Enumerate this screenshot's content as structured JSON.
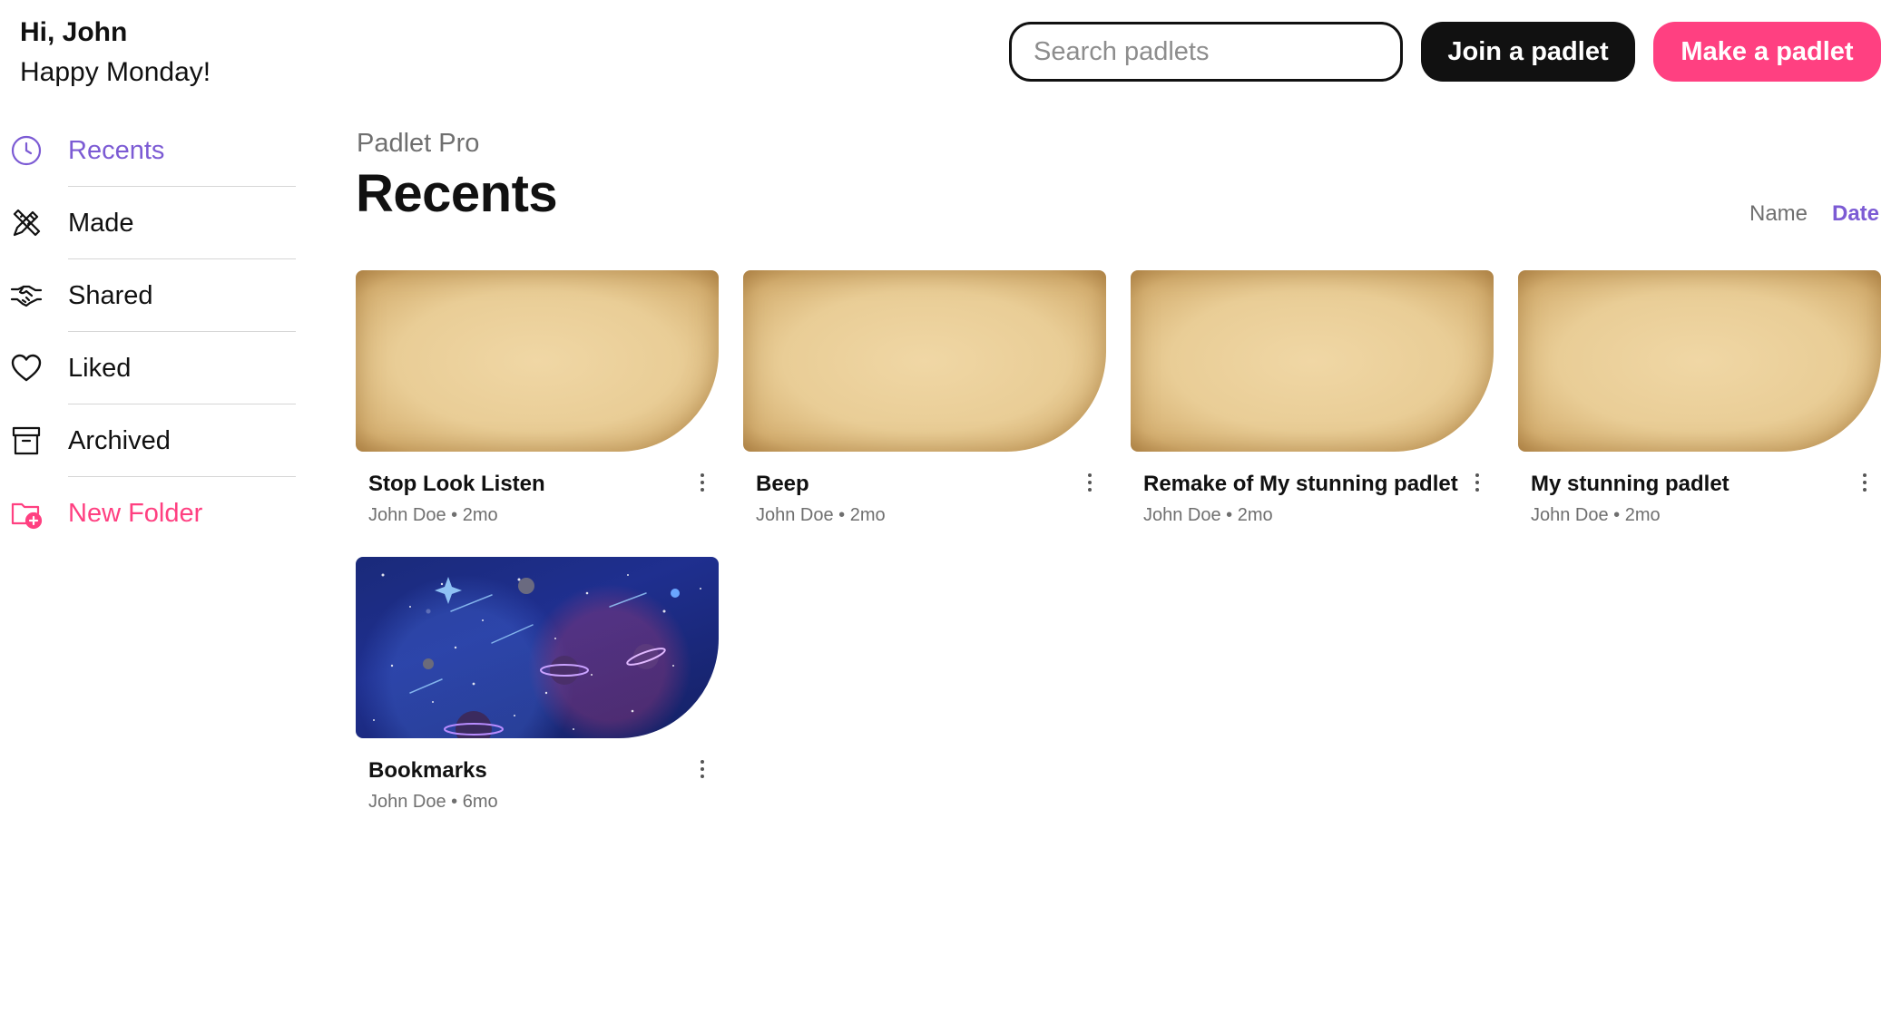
{
  "greeting": {
    "hi": "Hi, John",
    "day": "Happy Monday!"
  },
  "header": {
    "search_placeholder": "Search padlets",
    "join_label": "Join a padlet",
    "make_label": "Make a padlet"
  },
  "sidebar": {
    "items": [
      {
        "label": "Recents",
        "icon": "clock-icon",
        "active": true
      },
      {
        "label": "Made",
        "icon": "pencil-ruler-icon"
      },
      {
        "label": "Shared",
        "icon": "handshake-icon"
      },
      {
        "label": "Liked",
        "icon": "heart-icon"
      },
      {
        "label": "Archived",
        "icon": "archive-box-icon"
      },
      {
        "label": "New Folder",
        "icon": "new-folder-icon"
      }
    ]
  },
  "main": {
    "kicker": "Padlet Pro",
    "title": "Recents",
    "sort": {
      "name": "Name",
      "date": "Date",
      "selected": "Date"
    }
  },
  "cards": [
    {
      "title": "Stop Look Listen",
      "author": "John Doe",
      "age": "2mo",
      "meta": "John Doe • 2mo",
      "thumb": "parchment"
    },
    {
      "title": "Beep",
      "author": "John Doe",
      "age": "2mo",
      "meta": "John Doe • 2mo",
      "thumb": "parchment"
    },
    {
      "title": "Remake of My stunning padlet",
      "author": "John Doe",
      "age": "2mo",
      "meta": "John Doe • 2mo",
      "thumb": "parchment"
    },
    {
      "title": "My stunning padlet",
      "author": "John Doe",
      "age": "2mo",
      "meta": "John Doe • 2mo",
      "thumb": "parchment"
    },
    {
      "title": "Bookmarks",
      "author": "John Doe",
      "age": "6mo",
      "meta": "John Doe • 6mo",
      "thumb": "space"
    }
  ],
  "colors": {
    "accent_purple": "#7c5bd4",
    "accent_pink": "#ff4081",
    "text_primary": "#111111",
    "text_muted": "#6f6f6f"
  }
}
